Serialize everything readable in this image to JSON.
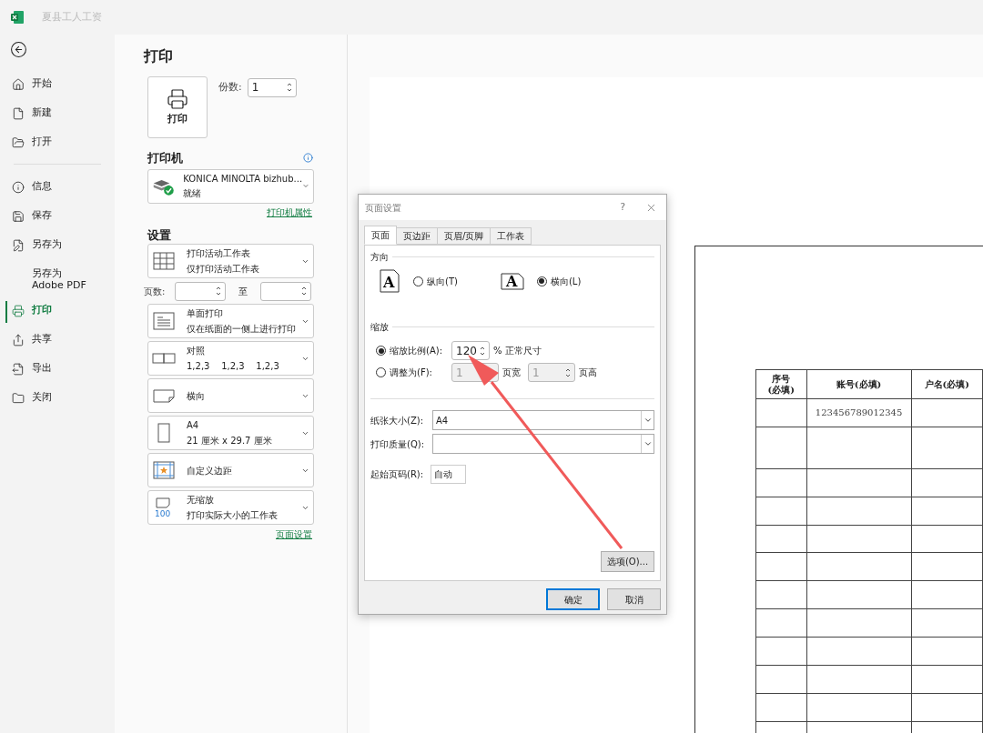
{
  "app": {
    "title": "夏县工人工资"
  },
  "nav": {
    "groups": [
      [
        {
          "label": "开始",
          "selected": false
        },
        {
          "label": "新建",
          "selected": false
        },
        {
          "label": "打开",
          "selected": false
        }
      ],
      [
        {
          "label": "信息",
          "selected": false
        },
        {
          "label": "保存",
          "selected": false
        },
        {
          "label": "另存为",
          "selected": false
        },
        {
          "label": "另存为 Adobe PDF",
          "selected": false
        },
        {
          "label": "打印",
          "selected": true
        },
        {
          "label": "共享",
          "selected": false
        },
        {
          "label": "导出",
          "selected": false
        },
        {
          "label": "关闭",
          "selected": false
        }
      ]
    ]
  },
  "print": {
    "title": "打印",
    "button": "打印",
    "copies_label": "份数:",
    "copies_value": "1",
    "printer_heading": "打印机",
    "printer_name": "KONICA MINOLTA bizhub...",
    "printer_status": "就绪",
    "printer_link": "打印机属性",
    "settings_heading": "设置",
    "settings": [
      {
        "kind": "dropdown",
        "line1": "打印活动工作表",
        "line2": "仅打印活动工作表"
      },
      {
        "kind": "pages",
        "label": "页数:",
        "to": "至"
      },
      {
        "kind": "dropdown",
        "line1": "单面打印",
        "line2": "仅在纸面的一侧上进行打印"
      },
      {
        "kind": "dropdown",
        "line1": "对照",
        "line2": "1,2,3    1,2,3    1,2,3"
      },
      {
        "kind": "dropdown",
        "line1": "横向"
      },
      {
        "kind": "dropdown",
        "line1": "A4",
        "line2": "21 厘米 x 29.7 厘米"
      },
      {
        "kind": "dropdown",
        "line1": "自定义边距"
      },
      {
        "kind": "dropdown",
        "line1": "无缩放",
        "line2": "打印实际大小的工作表",
        "icon_text": "100"
      }
    ],
    "setup_link": "页面设置"
  },
  "dialog": {
    "title": "页面设置",
    "help": "?",
    "tabs": [
      {
        "label": "页面",
        "selected": true
      },
      {
        "label": "页边距",
        "selected": false
      },
      {
        "label": "页眉/页脚",
        "selected": false
      },
      {
        "label": "工作表",
        "selected": false
      }
    ],
    "orientation_heading": "方向",
    "orientations": [
      {
        "label": "纵向(T)",
        "selected": false,
        "icon_text": "A"
      },
      {
        "label": "横向(L)",
        "selected": true,
        "icon_text": "A"
      }
    ],
    "scaling_heading": "缩放",
    "scale": {
      "label": "缩放比例(A):",
      "selected": true,
      "value": "120",
      "suffix": "% 正常尺寸"
    },
    "fit": {
      "label": "调整为(F):",
      "selected": false,
      "wide_value": "1",
      "wide_label": "页宽",
      "tall_value": "1",
      "tall_label": "页高"
    },
    "paper_size": {
      "label": "纸张大小(Z):",
      "value": "A4"
    },
    "print_quality": {
      "label": "打印质量(Q):"
    },
    "first_page": {
      "label": "起始页码(R):",
      "value": "自动"
    },
    "options_button": "选项(O)...",
    "ok": "确定",
    "cancel": "取消"
  },
  "preview": {
    "columns": [
      "序号\n(必填)",
      "账号(必填)",
      "户名(必填)"
    ],
    "rows": [
      {
        "col_2": "123456789012345"
      },
      {},
      {},
      {},
      {},
      {},
      {},
      {},
      {},
      {},
      {},
      {}
    ]
  }
}
